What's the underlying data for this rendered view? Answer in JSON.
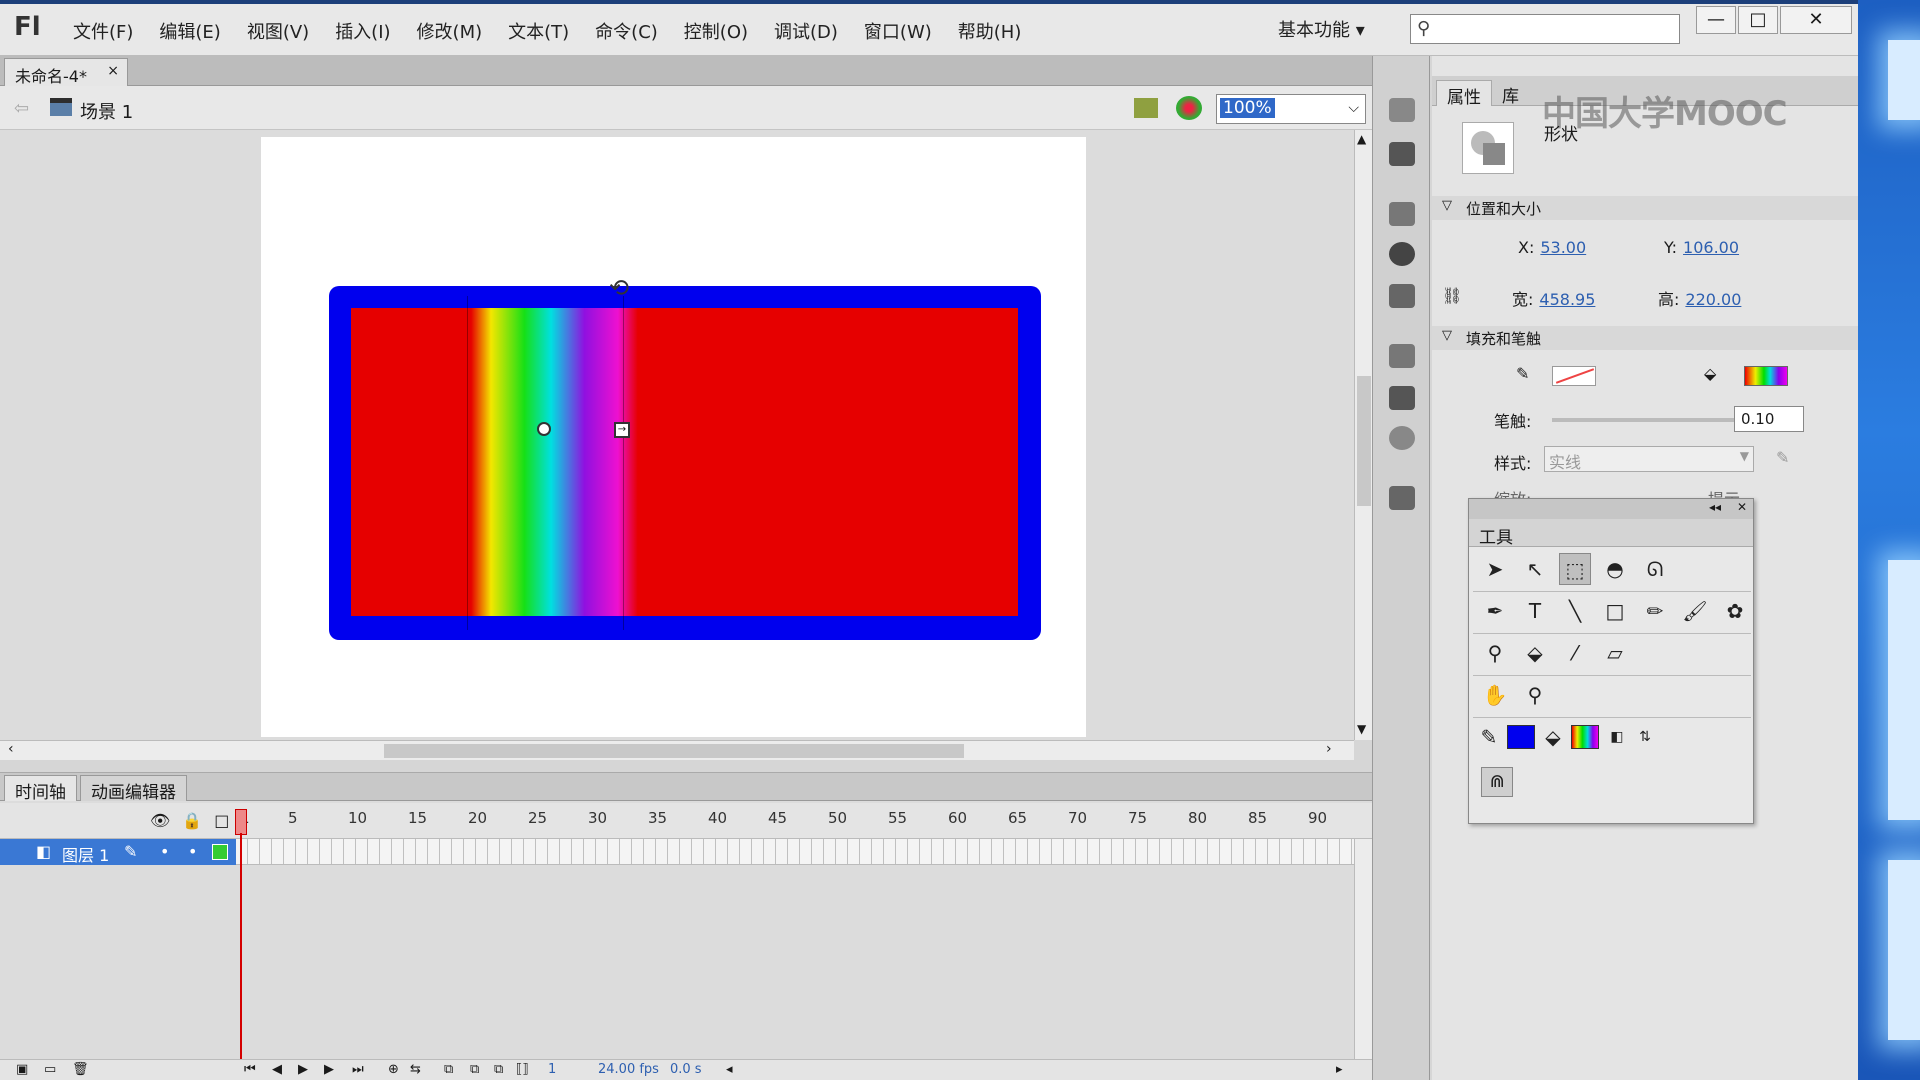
{
  "app": {
    "logo": "Fl",
    "menu": [
      "文件(F)",
      "编辑(E)",
      "视图(V)",
      "插入(I)",
      "修改(M)",
      "文本(T)",
      "命令(C)",
      "控制(O)",
      "调试(D)",
      "窗口(W)",
      "帮助(H)"
    ],
    "workspace": "基本功能 ▾",
    "window_buttons": {
      "minimize": "—",
      "maximize": "□",
      "close": "✕"
    }
  },
  "document": {
    "tab_label": "未命名-4*",
    "tab_close": "×",
    "back_arrow": "⇦",
    "scene": "场景 1",
    "zoom": "100%",
    "zoom_arrow": "⌵"
  },
  "stage": {
    "stroke_color": "#0000ee",
    "fill_color": "#e60000",
    "rotate_cursor": "⟲"
  },
  "timeline": {
    "tabs": [
      "时间轴",
      "动画编辑器"
    ],
    "frame_numbers": [
      "1",
      "5",
      "10",
      "15",
      "20",
      "25",
      "30",
      "35",
      "40",
      "45",
      "50",
      "55",
      "60",
      "65",
      "70",
      "75",
      "80",
      "85",
      "90"
    ],
    "header_icons": [
      "eye-icon",
      "lock-icon",
      "outline-icon"
    ],
    "layer_name": "图层 1",
    "footer": {
      "current_frame": "1",
      "fps": "24.00 fps",
      "time": "0.0 s"
    }
  },
  "properties": {
    "tabs": [
      "属性",
      "库"
    ],
    "watermark": "中国大学MOOC",
    "object_type": "形状",
    "section_position": "位置和大小",
    "x_label": "X:",
    "x_value": "53.00",
    "y_label": "Y:",
    "y_value": "106.00",
    "w_label": "宽:",
    "w_value": "458.95",
    "h_label": "高:",
    "h_value": "220.00",
    "section_fill": "填充和笔触",
    "stroke_label": "笔触:",
    "stroke_value": "0.10",
    "style_label": "样式:",
    "style_value": "实线",
    "scale_label": "缩放:",
    "hint_label": "提示"
  },
  "tools": {
    "title": "工具",
    "rows": [
      [
        "selection-tool",
        "subselection-tool",
        "free-transform-tool",
        "3d-rotation-tool",
        "lasso-tool"
      ],
      [
        "pen-tool",
        "text-tool",
        "line-tool",
        "rectangle-tool",
        "pencil-tool",
        "brush-tool",
        "deco-tool"
      ],
      [
        "bone-tool",
        "paint-bucket-tool",
        "eyedropper-tool",
        "eraser-tool"
      ],
      [
        "hand-tool",
        "zoom-tool"
      ]
    ],
    "stroke_color": "#0000ee"
  }
}
